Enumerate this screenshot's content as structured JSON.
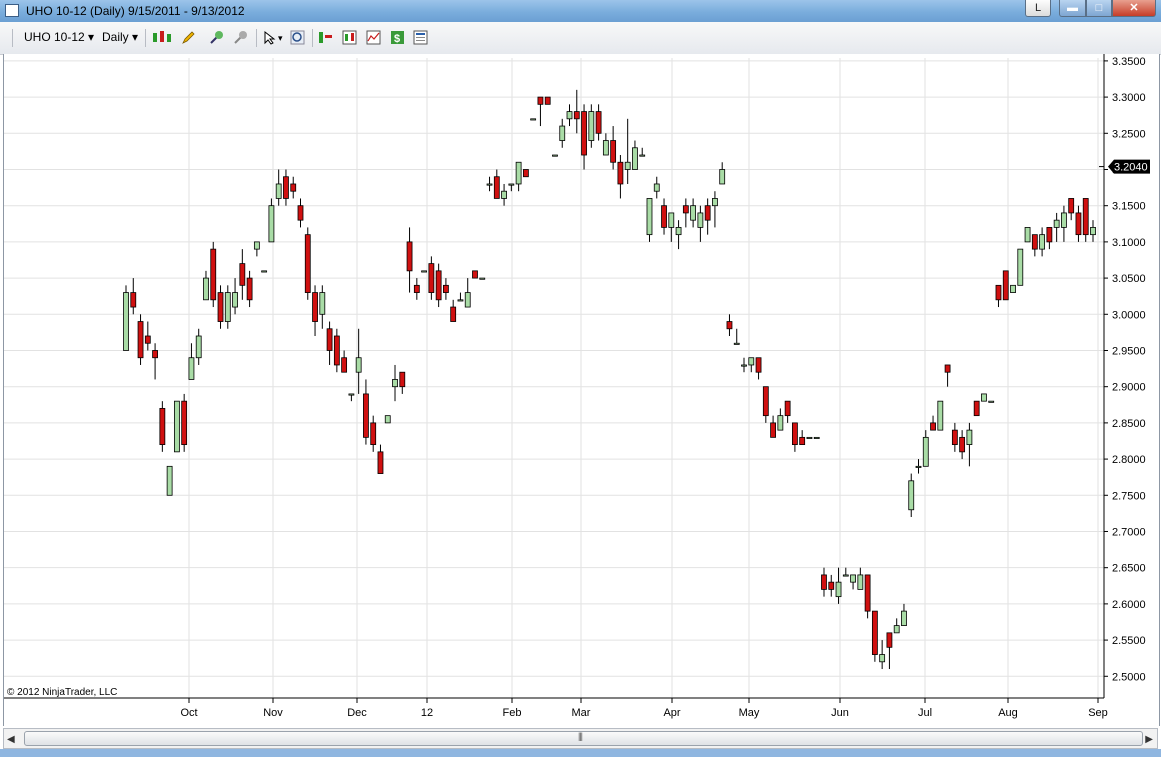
{
  "window": {
    "title": "UHO 10-12 (Daily)  9/15/2011 - 9/13/2012",
    "caption_buttons": {
      "extra": "L",
      "minimize": "▬",
      "maximize": "□",
      "close": "✕"
    }
  },
  "toolbar": {
    "instrument": "UHO 10-12",
    "period": "Daily"
  },
  "copyright": "© 2012 NinjaTrader, LLC",
  "colors": {
    "up": "#a9dca6",
    "down": "#d01010",
    "wick": "#000000",
    "grid": "#e2e2e2"
  },
  "chart_data": {
    "type": "candlestick",
    "x_tick_labels": [
      "Oct",
      "Nov",
      "Dec",
      "12",
      "Feb",
      "Mar",
      "Apr",
      "May",
      "Jun",
      "Jul",
      "Aug",
      "Sep"
    ],
    "y_tick_labels": [
      "3.3500",
      "3.3000",
      "3.2500",
      "3.2000",
      "3.1500",
      "3.1000",
      "3.0500",
      "3.0000",
      "2.9500",
      "2.9000",
      "2.8500",
      "2.8000",
      "2.7500",
      "2.7000",
      "2.6500",
      "2.6000",
      "2.5500",
      "2.5000"
    ],
    "ylim": [
      2.47,
      3.354
    ],
    "last_price": "3.2040",
    "grid": true,
    "candles": [
      [
        2.95,
        3.03,
        2.95,
        3.04
      ],
      [
        3.03,
        3.01,
        3.0,
        3.05
      ],
      [
        2.99,
        2.94,
        2.93,
        3.0
      ],
      [
        2.97,
        2.96,
        2.95,
        2.99
      ],
      [
        2.95,
        2.94,
        2.91,
        2.96
      ],
      [
        2.87,
        2.82,
        2.81,
        2.88
      ],
      [
        2.75,
        2.79,
        2.75,
        2.79
      ],
      [
        2.81,
        2.88,
        2.81,
        2.88
      ],
      [
        2.88,
        2.82,
        2.81,
        2.89
      ],
      [
        2.91,
        2.94,
        2.91,
        2.96
      ],
      [
        2.94,
        2.97,
        2.93,
        2.98
      ],
      [
        3.02,
        3.05,
        3.02,
        3.06
      ],
      [
        3.09,
        3.02,
        3.01,
        3.1
      ],
      [
        3.03,
        2.99,
        2.98,
        3.04
      ],
      [
        2.99,
        3.03,
        2.98,
        3.04
      ],
      [
        3.01,
        3.03,
        3.0,
        3.05
      ],
      [
        3.07,
        3.04,
        3.02,
        3.09
      ],
      [
        3.05,
        3.02,
        3.01,
        3.06
      ],
      [
        3.09,
        3.1,
        3.08,
        3.1
      ],
      [
        3.06,
        3.06,
        3.06,
        3.06
      ],
      [
        3.1,
        3.15,
        3.1,
        3.16
      ],
      [
        3.16,
        3.18,
        3.15,
        3.2
      ],
      [
        3.19,
        3.16,
        3.15,
        3.2
      ],
      [
        3.18,
        3.17,
        3.16,
        3.19
      ],
      [
        3.15,
        3.13,
        3.12,
        3.16
      ],
      [
        3.11,
        3.03,
        3.02,
        3.12
      ],
      [
        3.03,
        2.99,
        2.97,
        3.04
      ],
      [
        3.0,
        3.03,
        2.98,
        3.04
      ],
      [
        2.98,
        2.95,
        2.93,
        2.99
      ],
      [
        2.97,
        2.93,
        2.92,
        2.98
      ],
      [
        2.94,
        2.92,
        2.92,
        2.95
      ],
      [
        2.89,
        2.89,
        2.88,
        2.89
      ],
      [
        2.92,
        2.94,
        2.89,
        2.98
      ],
      [
        2.89,
        2.83,
        2.82,
        2.91
      ],
      [
        2.85,
        2.82,
        2.81,
        2.86
      ],
      [
        2.81,
        2.78,
        2.78,
        2.82
      ],
      [
        2.85,
        2.86,
        2.85,
        2.86
      ],
      [
        2.9,
        2.91,
        2.88,
        2.93
      ],
      [
        2.92,
        2.9,
        2.89,
        2.92
      ],
      [
        3.1,
        3.06,
        3.03,
        3.12
      ],
      [
        3.04,
        3.03,
        3.02,
        3.05
      ],
      [
        3.06,
        3.06,
        3.06,
        3.06
      ],
      [
        3.07,
        3.03,
        3.02,
        3.08
      ],
      [
        3.06,
        3.02,
        3.01,
        3.07
      ],
      [
        3.04,
        3.03,
        3.02,
        3.05
      ],
      [
        3.01,
        2.99,
        2.99,
        3.02
      ],
      [
        3.02,
        3.02,
        3.02,
        3.03
      ],
      [
        3.01,
        3.03,
        3.01,
        3.05
      ],
      [
        3.06,
        3.05,
        3.05,
        3.06
      ],
      [
        3.05,
        3.05,
        3.05,
        3.05
      ],
      [
        3.18,
        3.18,
        3.17,
        3.19
      ],
      [
        3.19,
        3.16,
        3.16,
        3.2
      ],
      [
        3.16,
        3.17,
        3.15,
        3.18
      ],
      [
        3.18,
        3.18,
        3.17,
        3.18
      ],
      [
        3.18,
        3.21,
        3.17,
        3.21
      ],
      [
        3.2,
        3.19,
        3.19,
        3.2
      ],
      [
        3.27,
        3.27,
        3.27,
        3.27
      ],
      [
        3.3,
        3.29,
        3.26,
        3.3
      ],
      [
        3.3,
        3.29,
        3.29,
        3.3
      ],
      [
        3.22,
        3.22,
        3.22,
        3.22
      ],
      [
        3.24,
        3.26,
        3.23,
        3.27
      ],
      [
        3.27,
        3.28,
        3.26,
        3.29
      ],
      [
        3.28,
        3.27,
        3.25,
        3.31
      ],
      [
        3.28,
        3.22,
        3.2,
        3.29
      ],
      [
        3.24,
        3.28,
        3.23,
        3.29
      ],
      [
        3.28,
        3.25,
        3.24,
        3.29
      ],
      [
        3.22,
        3.24,
        3.22,
        3.25
      ],
      [
        3.24,
        3.21,
        3.2,
        3.26
      ],
      [
        3.21,
        3.18,
        3.16,
        3.22
      ],
      [
        3.2,
        3.21,
        3.18,
        3.27
      ],
      [
        3.2,
        3.23,
        3.2,
        3.24
      ],
      [
        3.22,
        3.22,
        3.22,
        3.23
      ],
      [
        3.11,
        3.16,
        3.1,
        3.16
      ],
      [
        3.17,
        3.18,
        3.16,
        3.19
      ],
      [
        3.15,
        3.12,
        3.11,
        3.16
      ],
      [
        3.12,
        3.14,
        3.1,
        3.14
      ],
      [
        3.11,
        3.12,
        3.09,
        3.13
      ],
      [
        3.15,
        3.14,
        3.12,
        3.16
      ],
      [
        3.13,
        3.15,
        3.12,
        3.16
      ],
      [
        3.12,
        3.14,
        3.1,
        3.15
      ],
      [
        3.15,
        3.13,
        3.11,
        3.16
      ],
      [
        3.15,
        3.16,
        3.12,
        3.17
      ],
      [
        3.18,
        3.2,
        3.18,
        3.21
      ],
      [
        2.99,
        2.98,
        2.97,
        3.0
      ],
      [
        2.96,
        2.96,
        2.96,
        2.98
      ],
      [
        2.93,
        2.93,
        2.92,
        2.94
      ],
      [
        2.93,
        2.94,
        2.92,
        2.94
      ],
      [
        2.94,
        2.92,
        2.91,
        2.94
      ],
      [
        2.9,
        2.86,
        2.85,
        2.9
      ],
      [
        2.85,
        2.83,
        2.83,
        2.86
      ],
      [
        2.84,
        2.86,
        2.84,
        2.87
      ],
      [
        2.88,
        2.86,
        2.85,
        2.88
      ],
      [
        2.85,
        2.82,
        2.81,
        2.85
      ],
      [
        2.83,
        2.82,
        2.82,
        2.84
      ],
      [
        2.83,
        2.83,
        2.83,
        2.83
      ],
      [
        2.83,
        2.83,
        2.83,
        2.83
      ],
      [
        2.64,
        2.62,
        2.61,
        2.65
      ],
      [
        2.63,
        2.62,
        2.61,
        2.64
      ],
      [
        2.61,
        2.63,
        2.6,
        2.65
      ],
      [
        2.64,
        2.64,
        2.64,
        2.65
      ],
      [
        2.63,
        2.64,
        2.62,
        2.64
      ],
      [
        2.62,
        2.64,
        2.62,
        2.65
      ],
      [
        2.64,
        2.59,
        2.58,
        2.64
      ],
      [
        2.59,
        2.53,
        2.52,
        2.59
      ],
      [
        2.52,
        2.53,
        2.51,
        2.55
      ],
      [
        2.56,
        2.54,
        2.51,
        2.56
      ],
      [
        2.56,
        2.57,
        2.56,
        2.58
      ],
      [
        2.57,
        2.59,
        2.57,
        2.6
      ],
      [
        2.73,
        2.77,
        2.72,
        2.78
      ],
      [
        2.79,
        2.79,
        2.78,
        2.8
      ],
      [
        2.79,
        2.83,
        2.79,
        2.84
      ],
      [
        2.85,
        2.84,
        2.84,
        2.86
      ],
      [
        2.84,
        2.88,
        2.84,
        2.88
      ],
      [
        2.93,
        2.92,
        2.9,
        2.93
      ],
      [
        2.84,
        2.82,
        2.81,
        2.85
      ],
      [
        2.83,
        2.81,
        2.8,
        2.84
      ],
      [
        2.82,
        2.84,
        2.79,
        2.85
      ],
      [
        2.88,
        2.86,
        2.86,
        2.88
      ],
      [
        2.88,
        2.89,
        2.88,
        2.89
      ],
      [
        2.88,
        2.88,
        2.88,
        2.88
      ],
      [
        3.04,
        3.02,
        3.01,
        3.04
      ],
      [
        3.06,
        3.02,
        3.02,
        3.06
      ],
      [
        3.03,
        3.04,
        3.03,
        3.04
      ],
      [
        3.04,
        3.09,
        3.04,
        3.09
      ],
      [
        3.1,
        3.12,
        3.1,
        3.12
      ],
      [
        3.11,
        3.09,
        3.08,
        3.11
      ],
      [
        3.09,
        3.11,
        3.08,
        3.12
      ],
      [
        3.12,
        3.1,
        3.09,
        3.12
      ],
      [
        3.12,
        3.13,
        3.1,
        3.14
      ],
      [
        3.12,
        3.14,
        3.1,
        3.15
      ],
      [
        3.16,
        3.14,
        3.13,
        3.16
      ],
      [
        3.14,
        3.11,
        3.1,
        3.15
      ],
      [
        3.16,
        3.11,
        3.1,
        3.16
      ],
      [
        3.11,
        3.12,
        3.1,
        3.13
      ]
    ]
  }
}
